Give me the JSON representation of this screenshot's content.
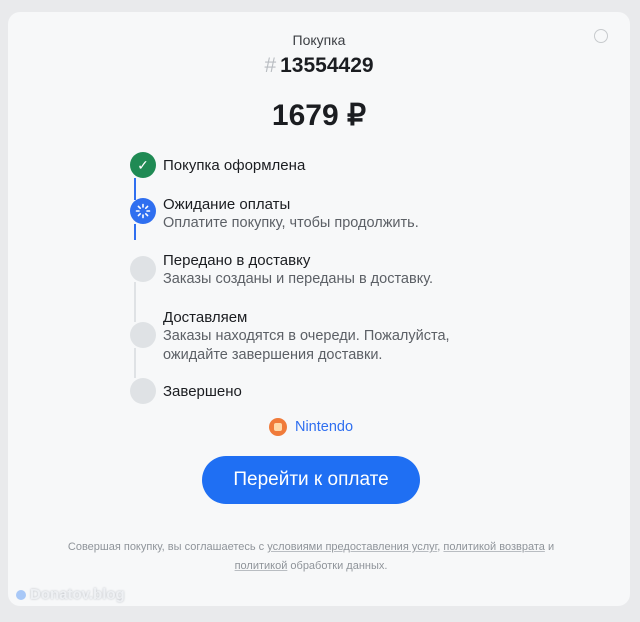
{
  "header": {
    "subtitle": "Покупка",
    "hash": "#",
    "order_number": "13554429",
    "price": "1679 ₽"
  },
  "steps": [
    {
      "title": "Покупка оформлена",
      "description": "",
      "state": "done",
      "icon": "check-icon"
    },
    {
      "title": "Ожидание оплаты",
      "description": "Оплатите покупку, чтобы продолжить.",
      "state": "active",
      "icon": "spinner-icon"
    },
    {
      "title": "Передано в доставку",
      "description": "Заказы созданы и переданы в доставку.",
      "state": "pending"
    },
    {
      "title": "Доставляем",
      "description": "Заказы находятся в очереди. Пожалуйста, ожидайте завершения доставки.",
      "state": "pending"
    },
    {
      "title": "Завершено",
      "description": "",
      "state": "pending"
    }
  ],
  "brand": {
    "label": "Nintendo",
    "icon": "nintendo-shop-icon"
  },
  "pay_button": {
    "label": "Перейти к оплате"
  },
  "legal": {
    "t1": "Совершая покупку, вы соглашаетесь с ",
    "l1": "условиями предоставления услуг",
    "t2": ", ",
    "l2": "политикой возврата",
    "t3": " и ",
    "l3": "политикой",
    "t4": " обработки данных."
  },
  "watermark": "Donatov.blog",
  "colors": {
    "accent": "#1f6ff3",
    "done": "#1f8a54",
    "pending": "#dfe2e5",
    "background": "#e9eaec",
    "card": "#f7f8f9"
  }
}
